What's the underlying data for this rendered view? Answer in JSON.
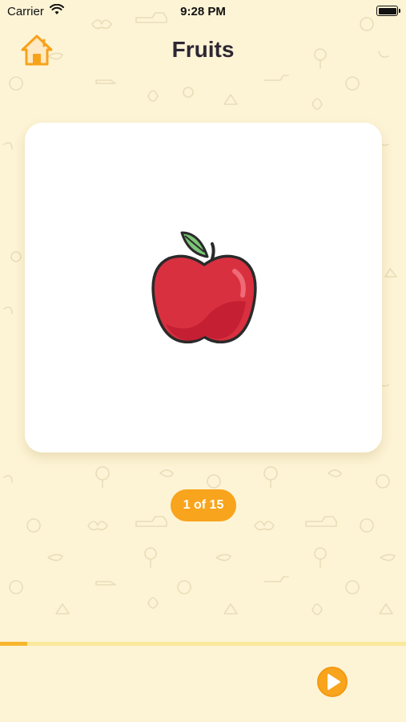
{
  "status_bar": {
    "carrier": "Carrier",
    "time": "9:28 PM",
    "wifi_icon": "wifi-icon",
    "battery_icon": "battery-icon"
  },
  "header": {
    "title": "Fruits",
    "home_icon": "home-icon"
  },
  "card": {
    "image_icon": "apple-icon"
  },
  "pager": {
    "counter_text": "1 of 15"
  },
  "progress": {
    "fraction": 0.067
  },
  "controls": {
    "play_icon": "play-icon"
  },
  "colors": {
    "background": "#fdf4d6",
    "accent_orange": "#f8a41c",
    "apple_red": "#d9303f",
    "leaf_green": "#7cc576"
  }
}
